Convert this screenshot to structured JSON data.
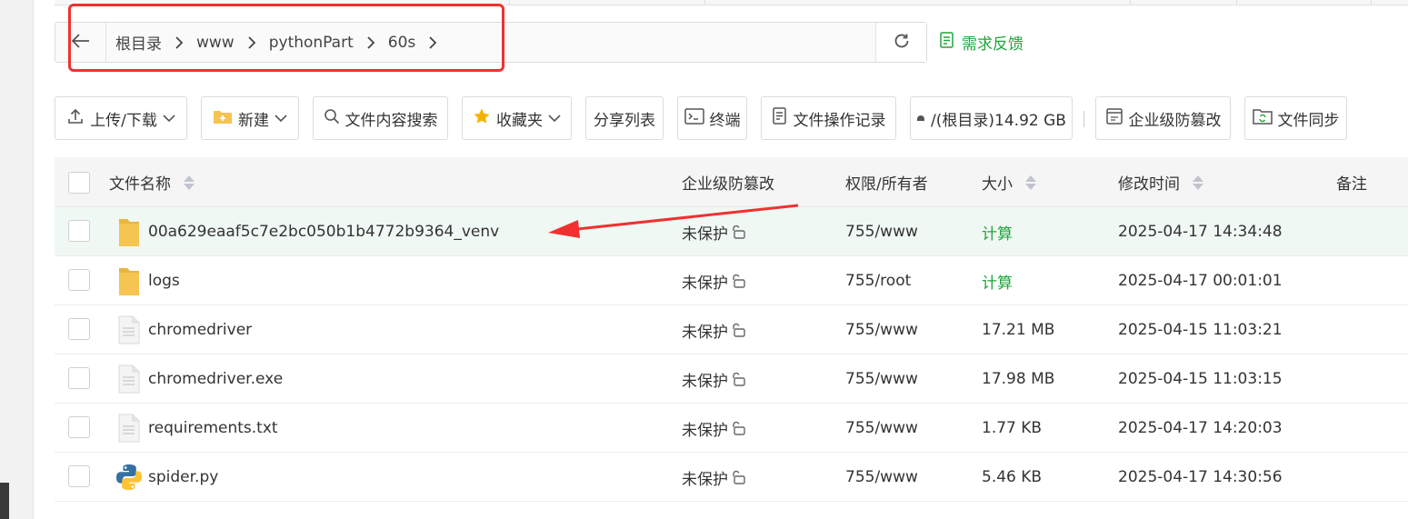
{
  "breadcrumb": {
    "items": [
      "根目录",
      "www",
      "pythonPart",
      "60s"
    ]
  },
  "feedback": {
    "label": "需求反馈"
  },
  "toolbar": {
    "upload": "上传/下载",
    "new": "新建",
    "search": "文件内容搜索",
    "favorites": "收藏夹",
    "share_list": "分享列表",
    "terminal": "终端",
    "operation_log": "文件操作记录",
    "disk": "/(根目录)14.92 GB",
    "tamper_proof": "企业级防篡改",
    "sync": "文件同步"
  },
  "table": {
    "headers": {
      "name": "文件名称",
      "tamper": "企业级防篡改",
      "perm": "权限/所有者",
      "size": "大小",
      "mtime": "修改时间",
      "note": "备注"
    },
    "rows": [
      {
        "name": "00a629eaaf5c7e2bc050b1b4772b9364_venv",
        "type": "folder",
        "protect": "未保护",
        "perm": "755/www",
        "size": "计算",
        "size_is_action": true,
        "mtime": "2025-04-17 14:34:48",
        "note": ""
      },
      {
        "name": "logs",
        "type": "folder",
        "protect": "未保护",
        "perm": "755/root",
        "size": "计算",
        "size_is_action": true,
        "mtime": "2025-04-17 00:01:01",
        "note": ""
      },
      {
        "name": "chromedriver",
        "type": "file",
        "protect": "未保护",
        "perm": "755/www",
        "size": "17.21 MB",
        "size_is_action": false,
        "mtime": "2025-04-15 11:03:21",
        "note": ""
      },
      {
        "name": "chromedriver.exe",
        "type": "file",
        "protect": "未保护",
        "perm": "755/www",
        "size": "17.98 MB",
        "size_is_action": false,
        "mtime": "2025-04-15 11:03:15",
        "note": ""
      },
      {
        "name": "requirements.txt",
        "type": "file",
        "protect": "未保护",
        "perm": "755/www",
        "size": "1.77 KB",
        "size_is_action": false,
        "mtime": "2025-04-17 14:20:03",
        "note": ""
      },
      {
        "name": "spider.py",
        "type": "python",
        "protect": "未保护",
        "perm": "755/www",
        "size": "5.46 KB",
        "size_is_action": false,
        "mtime": "2025-04-17 14:30:56",
        "note": ""
      }
    ]
  },
  "colors": {
    "accent_green": "#20a53a",
    "annotation_red": "#f23030",
    "row_highlight": "#f0f8f4",
    "folder_yellow": "#f5c451"
  }
}
